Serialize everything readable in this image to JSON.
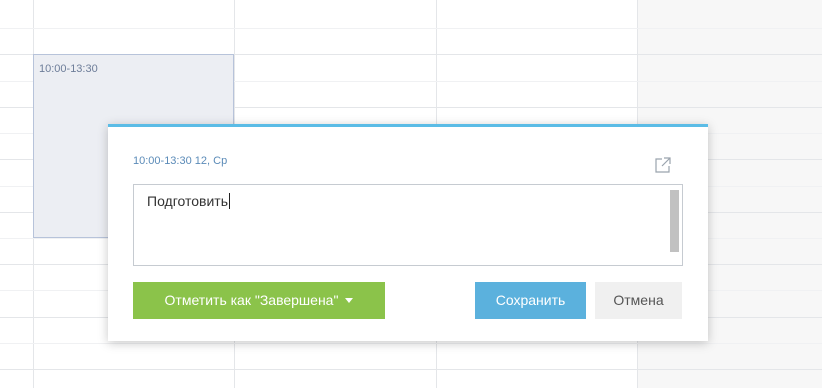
{
  "calendar": {
    "event_time": "10:00-13:30"
  },
  "popup": {
    "date_label": "10:00-13:30 12, Ср",
    "text_value": "Подготовить",
    "complete_button_label": "Отметить как \"Завершена\"",
    "save_button_label": "Сохранить",
    "cancel_button_label": "Отмена",
    "open_icon": "external-link-icon"
  },
  "colors": {
    "accent_top": "#5bbce6",
    "complete_green": "#8bc34a",
    "save_blue": "#5bb1dd",
    "event_fill": "#eceef3"
  }
}
